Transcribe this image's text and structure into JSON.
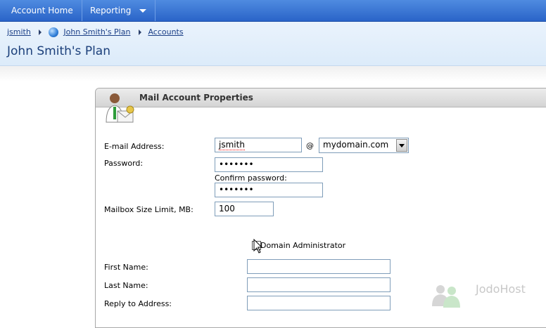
{
  "nav": {
    "home_label": "Account Home",
    "reporting_label": "Reporting"
  },
  "breadcrumb": {
    "items": [
      "jsmith",
      "John Smith's Plan",
      "Accounts"
    ]
  },
  "page_title": "John Smith's Plan",
  "panel": {
    "title": "Mail Account Properties",
    "email_label": "E-mail Address:",
    "email_value": "jsmith",
    "at_sign": "@",
    "domain_value": "mydomain.com",
    "password_label": "Password:",
    "password_value": "•••••••",
    "confirm_label": "Confirm password:",
    "confirm_value": "•••••••",
    "mailbox_label": "Mailbox Size Limit, MB:",
    "mailbox_value": "100",
    "domain_admin_label": "Domain Administrator",
    "first_name_label": "First Name:",
    "last_name_label": "Last Name:",
    "reply_label": "Reply to Address:"
  },
  "watermark": "JodoHost"
}
